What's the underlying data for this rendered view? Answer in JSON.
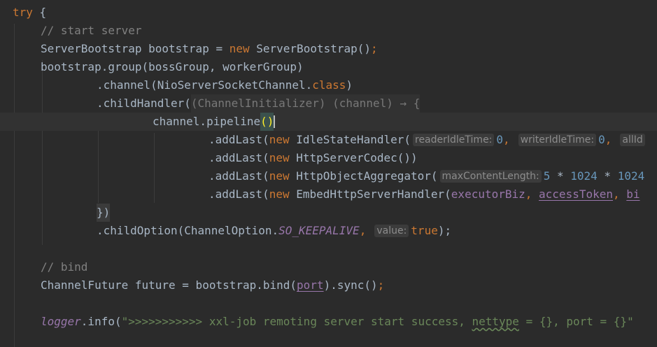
{
  "code": {
    "l1": {
      "try": "try",
      "brace": " {"
    },
    "l2": {
      "comment": "// start server"
    },
    "l3": {
      "type": "ServerBootstrap bootstrap = ",
      "new": "new",
      "ctor": " ServerBootstrap()",
      "semi": ";"
    },
    "l4": {
      "text": "bootstrap.group(bossGroup, workerGroup)"
    },
    "l5": {
      "pre": ".channel(NioServerSocketChannel.",
      "cls": "class",
      "post": ")"
    },
    "l6": {
      "pre": ".childHandler(",
      "lambda": "(ChannelInitializer) (channel) → {"
    },
    "l7": {
      "pre": "channel.pipeline",
      "parens": "()"
    },
    "l8": {
      "pre": ".addLast(",
      "new": "new",
      "ctor": " IdleStateHandler(",
      "hint1": "readerIdleTime:",
      "v1": "0",
      "c1": ",",
      "hint2": "writerIdleTime:",
      "v2": "0",
      "c2": ",",
      "hint3": "allId"
    },
    "l9": {
      "pre": ".addLast(",
      "new": "new",
      "ctor": " HttpServerCodec())"
    },
    "l10": {
      "pre": ".addLast(",
      "new": "new",
      "ctor": " HttpObjectAggregator(",
      "hint": "maxContentLength:",
      "v1": "5",
      "mid": " * ",
      "v2": "1024",
      "mid2": " * ",
      "v3": "1024"
    },
    "l11": {
      "pre": ".addLast(",
      "new": "new",
      "ctor": " EmbedHttpServerHandler(",
      "a1": "executorBiz",
      "c1": ", ",
      "a2": "accessToken",
      "c2": ", ",
      "a3": "bi"
    },
    "l12": {
      "text": "})"
    },
    "l13": {
      "pre": ".childOption(ChannelOption.",
      "field": "SO_KEEPALIVE",
      "comma": ",",
      "hint": "value:",
      "val": "true",
      "post": ");"
    },
    "l15": {
      "comment": "// bind"
    },
    "l16": {
      "pre": "ChannelFuture future = bootstrap.bind(",
      "arg": "port",
      "post": ").sync()",
      "semi": ";"
    },
    "l18": {
      "logger": "logger",
      "call": ".info(",
      "str1": "\">>>>>>>>>>> xxl-job remoting server start success, ",
      "squig": "nettype",
      "str2": " = {}, port = {}\""
    }
  }
}
